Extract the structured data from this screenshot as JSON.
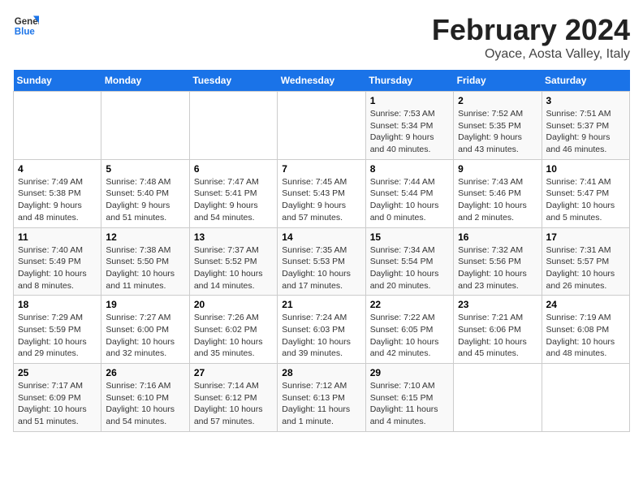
{
  "logo": {
    "line1": "General",
    "line2": "Blue"
  },
  "title": "February 2024",
  "subtitle": "Oyace, Aosta Valley, Italy",
  "columns": [
    "Sunday",
    "Monday",
    "Tuesday",
    "Wednesday",
    "Thursday",
    "Friday",
    "Saturday"
  ],
  "weeks": [
    [
      {
        "day": "",
        "info": ""
      },
      {
        "day": "",
        "info": ""
      },
      {
        "day": "",
        "info": ""
      },
      {
        "day": "",
        "info": ""
      },
      {
        "day": "1",
        "info": "Sunrise: 7:53 AM\nSunset: 5:34 PM\nDaylight: 9 hours\nand 40 minutes."
      },
      {
        "day": "2",
        "info": "Sunrise: 7:52 AM\nSunset: 5:35 PM\nDaylight: 9 hours\nand 43 minutes."
      },
      {
        "day": "3",
        "info": "Sunrise: 7:51 AM\nSunset: 5:37 PM\nDaylight: 9 hours\nand 46 minutes."
      }
    ],
    [
      {
        "day": "4",
        "info": "Sunrise: 7:49 AM\nSunset: 5:38 PM\nDaylight: 9 hours\nand 48 minutes."
      },
      {
        "day": "5",
        "info": "Sunrise: 7:48 AM\nSunset: 5:40 PM\nDaylight: 9 hours\nand 51 minutes."
      },
      {
        "day": "6",
        "info": "Sunrise: 7:47 AM\nSunset: 5:41 PM\nDaylight: 9 hours\nand 54 minutes."
      },
      {
        "day": "7",
        "info": "Sunrise: 7:45 AM\nSunset: 5:43 PM\nDaylight: 9 hours\nand 57 minutes."
      },
      {
        "day": "8",
        "info": "Sunrise: 7:44 AM\nSunset: 5:44 PM\nDaylight: 10 hours\nand 0 minutes."
      },
      {
        "day": "9",
        "info": "Sunrise: 7:43 AM\nSunset: 5:46 PM\nDaylight: 10 hours\nand 2 minutes."
      },
      {
        "day": "10",
        "info": "Sunrise: 7:41 AM\nSunset: 5:47 PM\nDaylight: 10 hours\nand 5 minutes."
      }
    ],
    [
      {
        "day": "11",
        "info": "Sunrise: 7:40 AM\nSunset: 5:49 PM\nDaylight: 10 hours\nand 8 minutes."
      },
      {
        "day": "12",
        "info": "Sunrise: 7:38 AM\nSunset: 5:50 PM\nDaylight: 10 hours\nand 11 minutes."
      },
      {
        "day": "13",
        "info": "Sunrise: 7:37 AM\nSunset: 5:52 PM\nDaylight: 10 hours\nand 14 minutes."
      },
      {
        "day": "14",
        "info": "Sunrise: 7:35 AM\nSunset: 5:53 PM\nDaylight: 10 hours\nand 17 minutes."
      },
      {
        "day": "15",
        "info": "Sunrise: 7:34 AM\nSunset: 5:54 PM\nDaylight: 10 hours\nand 20 minutes."
      },
      {
        "day": "16",
        "info": "Sunrise: 7:32 AM\nSunset: 5:56 PM\nDaylight: 10 hours\nand 23 minutes."
      },
      {
        "day": "17",
        "info": "Sunrise: 7:31 AM\nSunset: 5:57 PM\nDaylight: 10 hours\nand 26 minutes."
      }
    ],
    [
      {
        "day": "18",
        "info": "Sunrise: 7:29 AM\nSunset: 5:59 PM\nDaylight: 10 hours\nand 29 minutes."
      },
      {
        "day": "19",
        "info": "Sunrise: 7:27 AM\nSunset: 6:00 PM\nDaylight: 10 hours\nand 32 minutes."
      },
      {
        "day": "20",
        "info": "Sunrise: 7:26 AM\nSunset: 6:02 PM\nDaylight: 10 hours\nand 35 minutes."
      },
      {
        "day": "21",
        "info": "Sunrise: 7:24 AM\nSunset: 6:03 PM\nDaylight: 10 hours\nand 39 minutes."
      },
      {
        "day": "22",
        "info": "Sunrise: 7:22 AM\nSunset: 6:05 PM\nDaylight: 10 hours\nand 42 minutes."
      },
      {
        "day": "23",
        "info": "Sunrise: 7:21 AM\nSunset: 6:06 PM\nDaylight: 10 hours\nand 45 minutes."
      },
      {
        "day": "24",
        "info": "Sunrise: 7:19 AM\nSunset: 6:08 PM\nDaylight: 10 hours\nand 48 minutes."
      }
    ],
    [
      {
        "day": "25",
        "info": "Sunrise: 7:17 AM\nSunset: 6:09 PM\nDaylight: 10 hours\nand 51 minutes."
      },
      {
        "day": "26",
        "info": "Sunrise: 7:16 AM\nSunset: 6:10 PM\nDaylight: 10 hours\nand 54 minutes."
      },
      {
        "day": "27",
        "info": "Sunrise: 7:14 AM\nSunset: 6:12 PM\nDaylight: 10 hours\nand 57 minutes."
      },
      {
        "day": "28",
        "info": "Sunrise: 7:12 AM\nSunset: 6:13 PM\nDaylight: 11 hours\nand 1 minute."
      },
      {
        "day": "29",
        "info": "Sunrise: 7:10 AM\nSunset: 6:15 PM\nDaylight: 11 hours\nand 4 minutes."
      },
      {
        "day": "",
        "info": ""
      },
      {
        "day": "",
        "info": ""
      }
    ]
  ]
}
